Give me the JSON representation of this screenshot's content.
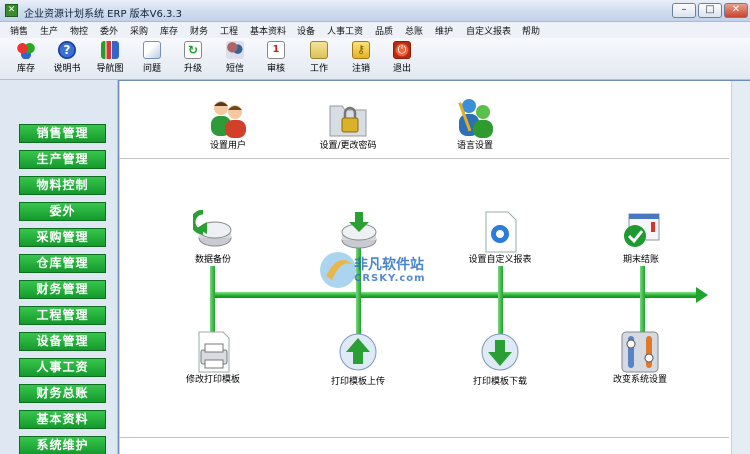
{
  "window": {
    "title": "企业资源计划系统 ERP 版本V6.3.3",
    "minimize": "–",
    "maximize": "□",
    "close": "✕"
  },
  "menu": [
    "销售",
    "生产",
    "物控",
    "委外",
    "采购",
    "库存",
    "财务",
    "工程",
    "基本资料",
    "设备",
    "人事工资",
    "品质",
    "总账",
    "维护",
    "自定义报表",
    "帮助"
  ],
  "toolbar": [
    {
      "label": "库存",
      "icon": "inventory-icon"
    },
    {
      "label": "说明书",
      "icon": "help-icon"
    },
    {
      "label": "导航图",
      "icon": "navigation-map-icon"
    },
    {
      "label": "问题",
      "icon": "issue-icon"
    },
    {
      "label": "升级",
      "icon": "upgrade-icon"
    },
    {
      "label": "短信",
      "icon": "sms-icon"
    },
    {
      "label": "审核",
      "icon": "audit-icon"
    },
    {
      "label": "工作",
      "icon": "work-icon"
    },
    {
      "label": "注销",
      "icon": "logout-key-icon"
    },
    {
      "label": "退出",
      "icon": "exit-icon"
    }
  ],
  "left_menu": [
    "销售管理",
    "生产管理",
    "物料控制",
    "委外",
    "采购管理",
    "仓库管理",
    "财务管理",
    "工程管理",
    "设备管理",
    "人事工资",
    "财务总账",
    "基本资料",
    "系统维护"
  ],
  "top_functions": [
    {
      "label": "设置用户",
      "icon": "users-icon"
    },
    {
      "label": "设置/更改密码",
      "icon": "password-lock-icon"
    },
    {
      "label": "语言设置",
      "icon": "language-icon"
    }
  ],
  "mid_functions": [
    {
      "label": "数据备份",
      "icon": "backup-icon"
    },
    {
      "label": "",
      "icon": "restore-icon"
    },
    {
      "label": "设置自定义报表",
      "icon": "custom-report-icon"
    },
    {
      "label": "期末结账",
      "icon": "period-close-icon"
    }
  ],
  "bottom_functions": [
    {
      "label": "修改打印模板",
      "icon": "print-template-icon"
    },
    {
      "label": "打印模板上传",
      "icon": "upload-icon"
    },
    {
      "label": "打印模板下载",
      "icon": "download-icon"
    },
    {
      "label": "改变系统设置",
      "icon": "system-settings-icon"
    }
  ],
  "watermark": {
    "line1": "非凡软件站",
    "line2": "CRSKY.com"
  }
}
